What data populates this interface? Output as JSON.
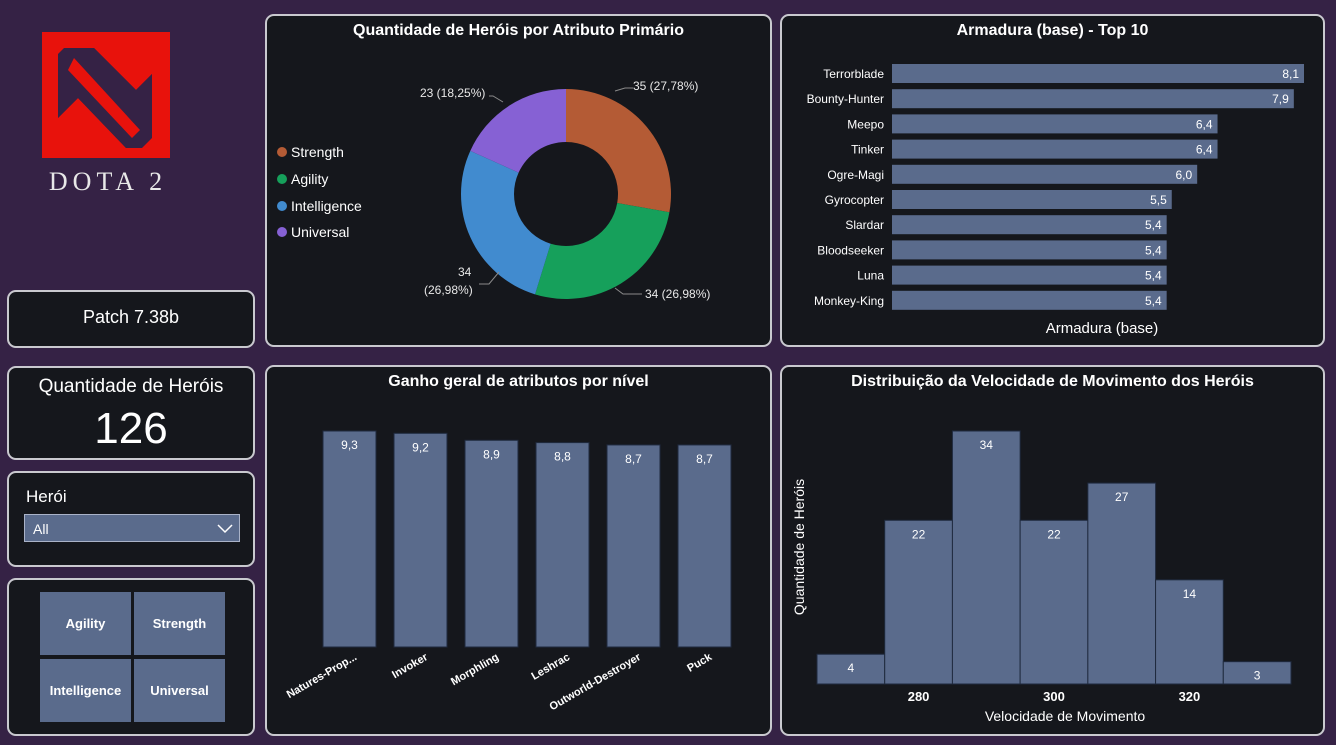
{
  "logo": {
    "text": "DOTA 2",
    "brand_color": "#e8120c"
  },
  "patch": {
    "label": "Patch 7.38b"
  },
  "hero_count": {
    "label": "Quantidade de Heróis",
    "value": "126"
  },
  "filter": {
    "label": "Herói",
    "selected": "All",
    "icon": "chevron-down-icon"
  },
  "attribute_buttons": [
    "Agility",
    "Strength",
    "Intelligence",
    "Universal"
  ],
  "colors": {
    "strength": "#b45b35",
    "agility": "#16a05b",
    "intelligence": "#418bcf",
    "universal": "#8661d4",
    "bar": "#5a6b8c"
  },
  "chart_data": [
    {
      "id": "donut",
      "type": "pie",
      "title": "Quantidade de Heróis por Atributo Primário",
      "slices": [
        {
          "name": "Strength",
          "value": 35,
          "label": "35 (27,78%)",
          "color": "#b45b35"
        },
        {
          "name": "Agility",
          "value": 34,
          "label": "34 (26,98%)",
          "color": "#16a05b"
        },
        {
          "name": "Intelligence",
          "value": 34,
          "label_line1": "34",
          "label_line2": "(26,98%)",
          "color": "#418bcf"
        },
        {
          "name": "Universal",
          "value": 23,
          "label": "23 (18,25%)",
          "color": "#8661d4"
        }
      ]
    },
    {
      "id": "armor",
      "type": "bar",
      "orientation": "horizontal",
      "title": "Armadura (base) - Top 10",
      "xlabel": "Armadura (base)",
      "categories": [
        "Terrorblade",
        "Bounty-Hunter",
        "Meepo",
        "Tinker",
        "Ogre-Magi",
        "Gyrocopter",
        "Slardar",
        "Bloodseeker",
        "Luna",
        "Monkey-King"
      ],
      "values": [
        8.1,
        7.9,
        6.4,
        6.4,
        6.0,
        5.5,
        5.4,
        5.4,
        5.4,
        5.4
      ],
      "value_labels": [
        "8,1",
        "7,9",
        "6,4",
        "6,4",
        "6,0",
        "5,5",
        "5,4",
        "5,4",
        "5,4",
        "5,4"
      ]
    },
    {
      "id": "gain",
      "type": "bar",
      "title": "Ganho geral de atributos por nível",
      "categories": [
        "Natures-Prop...",
        "Invoker",
        "Morphling",
        "Leshrac",
        "Outworld-Destroyer",
        "Puck"
      ],
      "values": [
        9.3,
        9.2,
        8.9,
        8.8,
        8.7,
        8.7
      ],
      "value_labels": [
        "9,3",
        "9,2",
        "8,9",
        "8,8",
        "8,7",
        "8,7"
      ]
    },
    {
      "id": "movement",
      "type": "bar",
      "subtype": "histogram",
      "title": "Distribuição da Velocidade de Movimento dos Heróis",
      "xlabel": "Velocidade de Movimento",
      "ylabel": "Quantidade de Heróis",
      "bin_edges": [
        265,
        275,
        285,
        295,
        305,
        315,
        325,
        335
      ],
      "values": [
        4,
        22,
        34,
        22,
        27,
        14,
        3
      ],
      "x_ticks": [
        280,
        300,
        320
      ],
      "xlim": [
        265,
        335
      ]
    }
  ]
}
